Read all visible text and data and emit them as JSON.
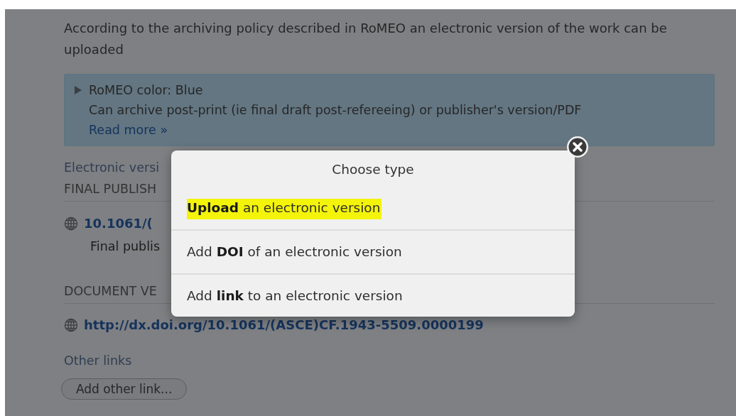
{
  "intro": "According to the archiving policy described in RoMEO an electronic version of the work can be uploaded",
  "romeo_box": {
    "expanded": false,
    "color_label": "RoMEO color: Blue",
    "description": "Can archive post-print (ie final draft post-refereeing) or publisher's version/PDF",
    "read_more": "Read more »"
  },
  "electronic_label": "Electronic versi",
  "final_heading": "FINAL PUBLISH",
  "final_link": "10.1061/(",
  "final_note": "Final publis",
  "document_heading": "DOCUMENT VE",
  "document_link": "http://dx.doi.org/10.1061/(ASCE)CF.1943-5509.0000199",
  "other_links_label": "Other links",
  "add_other_link_button": "Add other link...",
  "dialog": {
    "title": "Choose type",
    "options": [
      {
        "label": "**Upload** an electronic version",
        "highlighted": true
      },
      {
        "label": "Add **DOI** of an electronic version",
        "highlighted": false
      },
      {
        "label": "Add **link** to an electronic version",
        "highlighted": false
      }
    ]
  }
}
